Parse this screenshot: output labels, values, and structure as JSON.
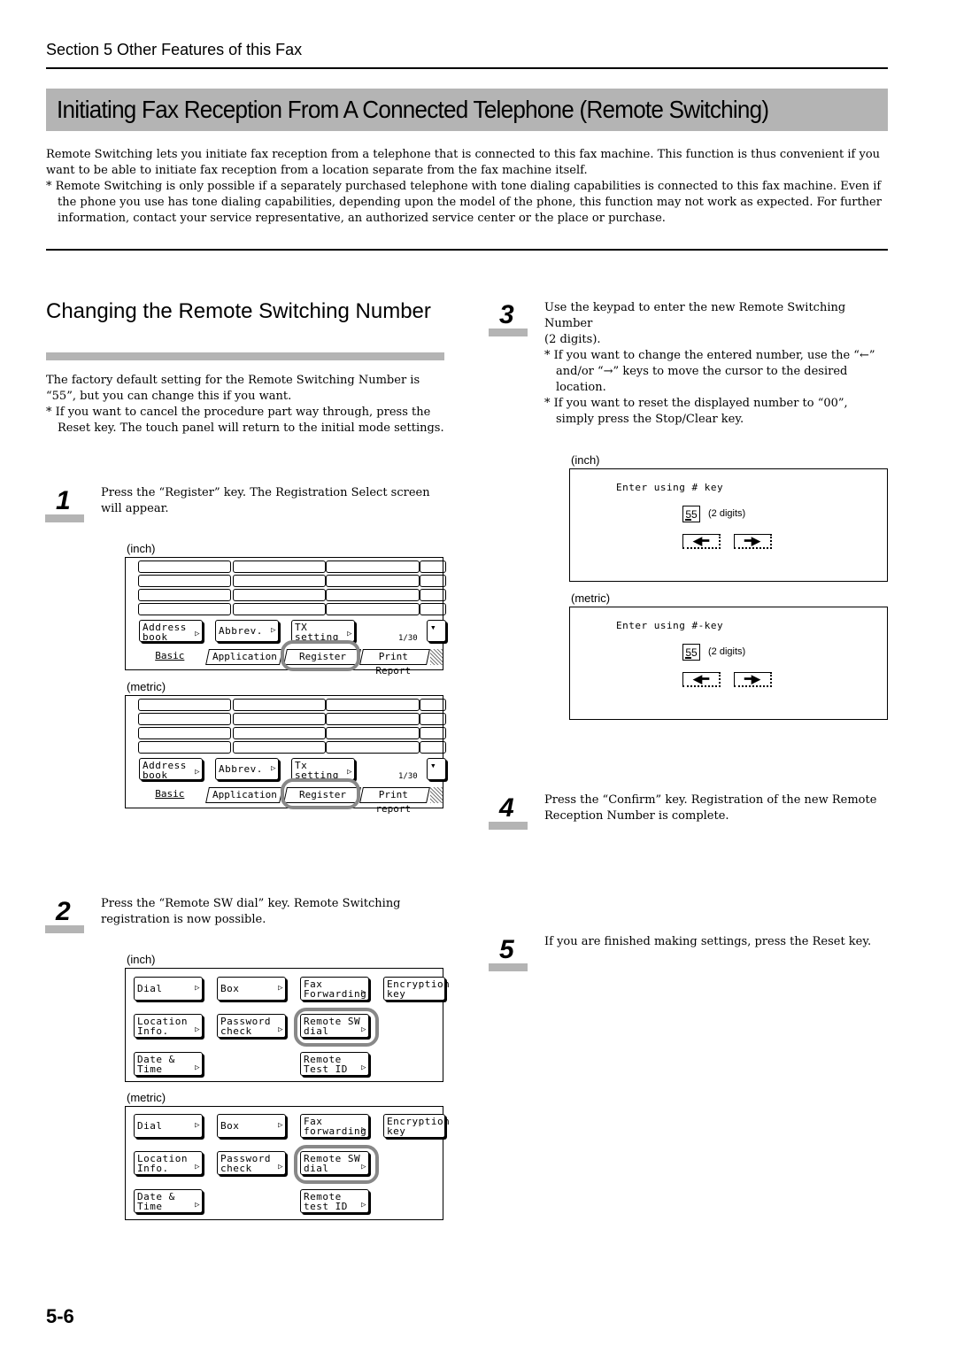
{
  "header": {
    "section": "Section 5  Other Features of this Fax",
    "title": "Initiating Fax Reception From A Connected Telephone  (Remote Switching)"
  },
  "intro": {
    "paragraph": "Remote Switching lets you initiate fax reception from a telephone that is connected to this fax machine. This function is thus convenient if you want to be able to initiate fax reception from a location separate from the fax machine itself.",
    "note": "* Remote Switching is only possible if a separately purchased telephone with tone dialing capabilities is connected to this fax machine. Even if the phone you use has tone dialing capabilities, depending upon the model of the phone, this function may not work as expected. For further information, contact your service representative, an authorized service center or the place or purchase."
  },
  "subsection": {
    "heading": "Changing the Remote Switching Number",
    "paragraph": "The factory default setting for the Remote Switching Number is “55”, but you can change this if you want.",
    "note": "* If you want to cancel the procedure part way through, press the Reset key. The touch panel will return to the initial mode settings."
  },
  "steps": [
    {
      "number": "1",
      "text": "Press the “Register” key. The Registration Select screen will appear."
    },
    {
      "number": "2",
      "text": "Press the “Remote SW dial” key. Remote Switching registration is now possible."
    },
    {
      "number": "3",
      "text": "Use the keypad to enter the new Remote Switching Number",
      "text2": "(2 digits).",
      "notes": [
        "* If you want to change the entered number, use the “←” and/or “→” keys to move the cursor to the desired location.",
        "* If you want to reset the displayed number to “00”, simply press the Stop/Clear key."
      ]
    },
    {
      "number": "4",
      "text": "Press the “Confirm” key. Registration of the new Remote Reception Number is complete."
    },
    {
      "number": "5",
      "text": "If you are finished making settings, press the Reset key."
    }
  ],
  "captions": {
    "inch": "(inch)",
    "metric": "(metric)"
  },
  "screen1": {
    "inch": {
      "keys": [
        "Address book",
        "Abbrev.",
        "TX setting"
      ],
      "page": "1/30",
      "tabs": [
        "Basic",
        "Application",
        "Register",
        "Print Report"
      ]
    },
    "metric": {
      "keys": [
        "Address book",
        "Abbrev.",
        "Tx setting"
      ],
      "page": "1/30",
      "tabs": [
        "Basic",
        "Application",
        "Register",
        "Print report"
      ]
    },
    "highlighted": "Register"
  },
  "screen2": {
    "inch": {
      "keys": [
        "Dial",
        "Box",
        "Fax Forwarding",
        "Encryption key",
        "Location Info.",
        "Password check",
        "Remote SW dial",
        "Date & Time",
        "Remote Test ID"
      ]
    },
    "metric": {
      "keys": [
        "Dial",
        "Box",
        "Fax forwarding",
        "Encryption key",
        "Location Info.",
        "Password check",
        "Remote SW dial",
        "Date & Time",
        "Remote test ID"
      ]
    },
    "highlighted": "Remote SW dial"
  },
  "screen3": {
    "inch": {
      "prompt": "Enter using # key",
      "value": "55",
      "digits": "(2 digits)",
      "left_arrow": "🡐",
      "right_arrow": "🡒"
    },
    "metric": {
      "prompt": "Enter using #-key",
      "value": "55",
      "digits": "(2 digits)",
      "left_arrow": "🡐",
      "right_arrow": "🡒"
    }
  },
  "footer": {
    "page_number": "5-6"
  }
}
